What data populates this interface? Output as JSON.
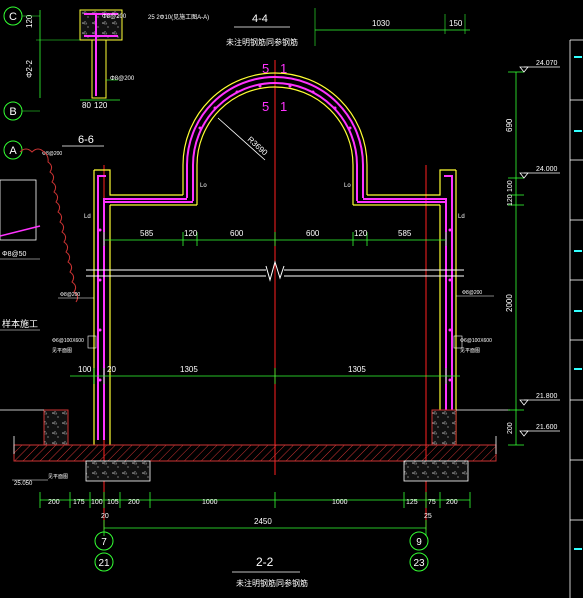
{
  "colors": {
    "background": "#000000",
    "wall": "#ffff33",
    "rebar": "#ff33ff",
    "axis": "#ff2020",
    "dimension": "#33ff33",
    "text": "#ffffff",
    "hatch": "#cc3333",
    "cyan": "#33ffff"
  },
  "axes_left": [
    {
      "letter": "C"
    },
    {
      "letter": "B"
    },
    {
      "letter": "A"
    }
  ],
  "bottom_axes": [
    {
      "top": "7",
      "bottom": "21"
    },
    {
      "top": "9",
      "bottom": "23"
    }
  ],
  "section_titles": {
    "s44": "4-4",
    "s44_sub": "未注明钢筋同参钢筋",
    "s66": "6-6",
    "s22": "2-2",
    "s22_sub": "未注明钢筋同参钢筋"
  },
  "section_marks": {
    "top": "5",
    "bottom": "5",
    "top_sub": "1",
    "bottom_sub": "1"
  },
  "arch_radius": "R3690",
  "top_dims": {
    "d1": "1030",
    "d2": "150"
  },
  "span_dims": [
    "585",
    "120",
    "600",
    "600",
    "120",
    "585"
  ],
  "mid_dims": [
    "100",
    "20",
    "1305",
    "1305"
  ],
  "bottom_dims": [
    "200",
    "175",
    "100",
    "105",
    "200",
    "1000",
    "1000",
    "125",
    "75",
    "200"
  ],
  "total_dim": "2450",
  "offset_labels": [
    "20",
    "25"
  ],
  "right_dims": [
    "690",
    "100",
    "120",
    "2000",
    "200"
  ],
  "elevations": [
    "24.070",
    "24.000",
    "21.800",
    "21.600"
  ],
  "left_elevation": "25.050",
  "detail_dims": {
    "a": "120",
    "b": "80",
    "c": "120",
    "d": "Φ2-2"
  },
  "ld_label": "Ld",
  "lo_label": "Lo",
  "notes": {
    "n1": "Φ8@200",
    "n2": "Φ8@200",
    "n3": "Φ8@200",
    "n4": "Φ8@200",
    "n5": "Φ8@50",
    "n6": "样本施工",
    "n7": "Φ6@100X600",
    "n8": "Φ6@100X600",
    "n9": "见平面图",
    "n10": "25 2Φ10(见施工图A-A)"
  }
}
